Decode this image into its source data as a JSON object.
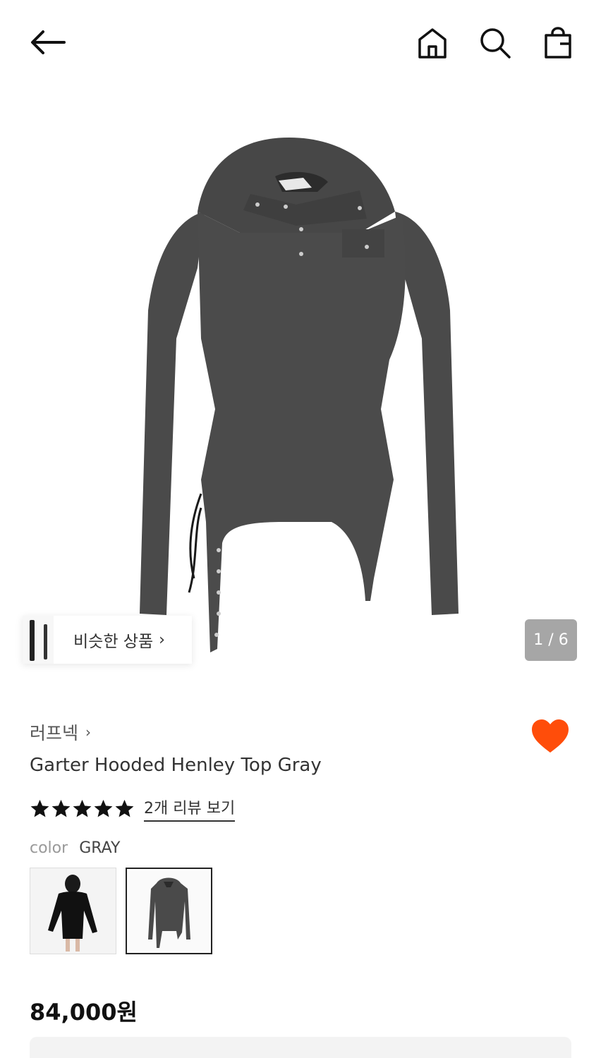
{
  "header": {
    "icons": [
      "arrow-left-icon",
      "home-icon",
      "search-icon",
      "shopping-bag-icon"
    ]
  },
  "gallery": {
    "similar_label": "비슷한 상품",
    "similar_chevron": "›",
    "pager": "1 / 6"
  },
  "product": {
    "brand": "러프넥",
    "brand_chevron": "›",
    "title": "Garter Hooded Henley Top Gray",
    "rating_stars": 5,
    "review_link": "2개 리뷰 보기",
    "color_label": "color",
    "color_value": "GRAY",
    "price": "84,000원",
    "wishlist_color": "#ff4d0a"
  },
  "colors": {
    "garment": "#4a4a4a",
    "accent_heart": "#ff4d0a",
    "pager_bg": "#a6a6a6"
  }
}
